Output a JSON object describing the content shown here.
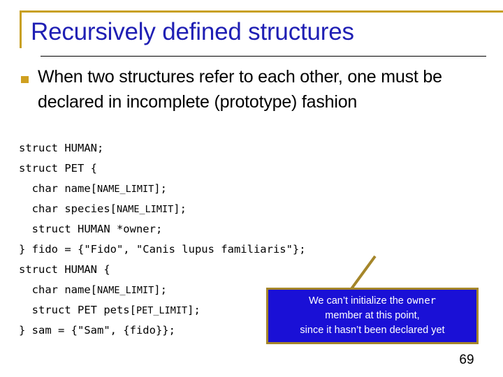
{
  "slide": {
    "title": "Recursively defined structures",
    "page_number": "69",
    "accent_gold": "#c8a022",
    "title_blue": "#1f1fb4",
    "callout_blue": "#1a10d6",
    "callout_border_gold": "#a5862a",
    "bullet_gold": "#cfa020"
  },
  "bullets": [
    {
      "marker": "square-bullet",
      "text": "When two structures refer to each other, one must be declared in incomplete (prototype) fashion"
    }
  ],
  "code": {
    "language": "c",
    "lines": [
      [
        {
          "t": "struct HUMAN;",
          "small": false
        }
      ],
      [
        {
          "t": "struct PET {",
          "small": false
        }
      ],
      [
        {
          "t": "  char name[",
          "small": false
        },
        {
          "t": "NAME_LIMIT",
          "small": true
        },
        {
          "t": "];",
          "small": false
        }
      ],
      [
        {
          "t": "  char species[",
          "small": false
        },
        {
          "t": "NAME_LIMIT",
          "small": true
        },
        {
          "t": "];",
          "small": false
        }
      ],
      [
        {
          "t": "  struct HUMAN *owner;",
          "small": false
        }
      ],
      [
        {
          "t": "} fido = {\"Fido\", \"Canis lupus familiaris\"};",
          "small": false
        }
      ],
      [
        {
          "t": "struct HUMAN {",
          "small": false
        }
      ],
      [
        {
          "t": "  char name[",
          "small": false
        },
        {
          "t": "NAME_LIMIT",
          "small": true
        },
        {
          "t": "];",
          "small": false
        }
      ],
      [
        {
          "t": "  struct PET pets[",
          "small": false
        },
        {
          "t": "PET_LIMIT",
          "small": true
        },
        {
          "t": "];",
          "small": false
        }
      ],
      [
        {
          "t": "} sam = {\"Sam\", {fido}};",
          "small": false
        }
      ]
    ]
  },
  "callout": {
    "line1_before": "We can’t initialize the ",
    "line1_code": "owner",
    "line2": "member at this point,",
    "line3": "since it hasn’t been declared yet"
  }
}
